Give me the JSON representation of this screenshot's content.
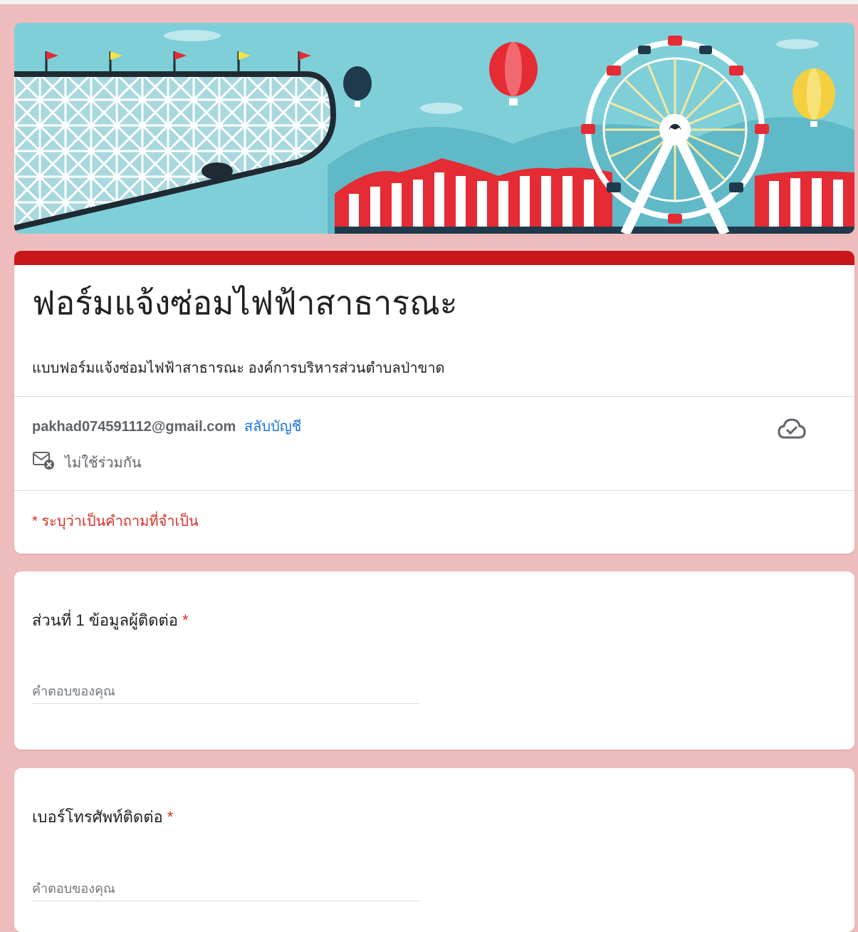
{
  "form": {
    "title": "ฟอร์มแจ้งซ่อมไฟฟ้าสาธารณะ",
    "description": "แบบฟอร์มแจ้งซ่อมไฟฟ้าสาธารณะ องค์การบริหารส่วนตำบลป่าขาด"
  },
  "account": {
    "email": "pakhad074591112@gmail.com",
    "switch_label": "สลับบัญชี",
    "not_shared_label": "ไม่ใช้ร่วมกัน"
  },
  "required_note": "* ระบุว่าเป็นคำถามที่จำเป็น",
  "questions": [
    {
      "label": "ส่วนที่ 1 ข้อมูลผู้ติดต่อ",
      "required_mark": "*",
      "placeholder": "คำตอบของคุณ"
    },
    {
      "label": "เบอร์โทรศัพท์ติดต่อ",
      "required_mark": "*",
      "placeholder": "คำตอบของคุณ"
    }
  ],
  "icons": {
    "cloud": "cloud-check-icon",
    "mail": "mail-off-icon"
  },
  "colors": {
    "background": "#eebcbc",
    "accent": "#c8161b",
    "link": "#1a73e8",
    "required": "#d93025"
  }
}
